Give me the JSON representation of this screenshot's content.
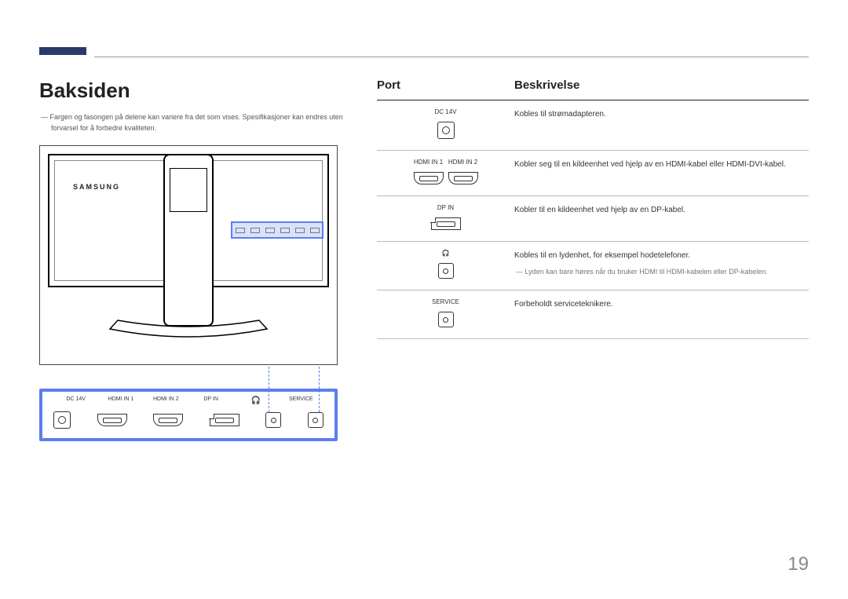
{
  "page_number": "19",
  "title": "Baksiden",
  "note": "Fargen og fasongen på delene kan variere fra det som vises. Spesifikasjoner kan endres uten forvarsel for å forbedre kvaliteten.",
  "brand": "SAMSUNG",
  "table": {
    "header": {
      "port": "Port",
      "description": "Beskrivelse"
    },
    "rows": [
      {
        "labels": [
          "DC 14V"
        ],
        "description": "Kobles til strømadapteren.",
        "note": null,
        "icon_type": "dc"
      },
      {
        "labels": [
          "HDMI IN 1",
          "HDMI IN 2"
        ],
        "description": "Kobler seg til en kildeenhet ved hjelp av en HDMI-kabel eller HDMI-DVI-kabel.",
        "note": null,
        "icon_type": "hdmi2"
      },
      {
        "labels": [
          "DP IN"
        ],
        "description": "Kobler til en kildeenhet ved hjelp av en DP-kabel.",
        "note": null,
        "icon_type": "dp"
      },
      {
        "labels": [
          ""
        ],
        "description": "Kobles til en lydenhet, for eksempel hodetelefoner.",
        "note": "Lyden kan bare høres når du bruker HDMI til HDMI-kabelen eller DP-kabelen.",
        "icon_type": "audio"
      },
      {
        "labels": [
          "SERVICE"
        ],
        "description": "Forbeholdt serviceteknikere.",
        "note": null,
        "icon_type": "service"
      }
    ]
  },
  "zoom": {
    "labels": [
      "DC 14V",
      "HDMI IN 1",
      "HDMI IN 2",
      "DP IN",
      "",
      "SERVICE"
    ],
    "headphone_glyph": "🎧"
  }
}
